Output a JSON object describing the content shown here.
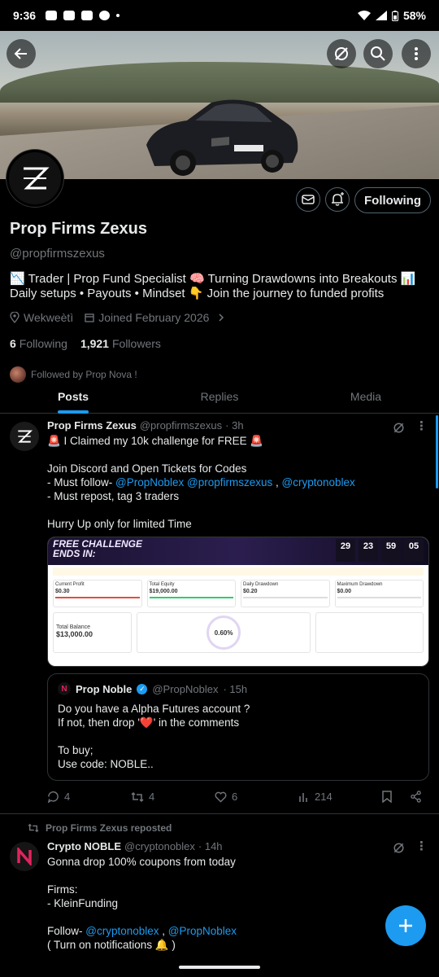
{
  "status_bar": {
    "time": "9:36",
    "battery": "58%"
  },
  "profile": {
    "display_name": "Prop Firms Zexus",
    "handle": "@propfirmszexus",
    "bio": "📉 Trader | Prop Fund Specialist 🧠 Turning Drawdowns into Breakouts 📊 Daily setups • Payouts • Mindset 👇 Join the journey to funded profits",
    "location": "Wekweètì",
    "joined": "Joined February 2026",
    "following_count": "6",
    "following_label": "Following",
    "followers_count": "1,921",
    "followers_label": "Followers",
    "followed_by": "Followed by Prop Nova !",
    "following_button": "Following"
  },
  "tabs": [
    {
      "label": "Posts",
      "active": true
    },
    {
      "label": "Replies",
      "active": false
    },
    {
      "label": "Media",
      "active": false
    }
  ],
  "post1": {
    "name": "Prop Firms Zexus",
    "handle": "@propfirmszexus",
    "time": "· 3h",
    "line1": "🚨 I Claimed my 10k challenge for FREE 🚨",
    "line2": "Join Discord and Open Tickets for Codes",
    "line3_prefix": "- Must follow- ",
    "mention1": "@PropNoblex",
    "mention2": "@propfirmszexus",
    "sep": " , ",
    "mention3": "@cryptonoblex",
    "line4": "- Must repost, tag 3 traders",
    "line5": "Hurry Up only for limited Time",
    "image": {
      "title1": "FREE CHALLENGE",
      "title2": "ENDS IN:",
      "counter": [
        "29",
        "23",
        "59",
        "05"
      ],
      "cards": [
        {
          "label": "Current Profit",
          "value": "$0.30"
        },
        {
          "label": "Total Equity",
          "value": "$19,000.00"
        },
        {
          "label": "Daily Drawdown",
          "value": "$0.20"
        },
        {
          "label": "Maximum Drawdown",
          "value": "$0.00"
        }
      ],
      "balance_label": "Total Balance",
      "balance_value": "$13,000.00",
      "circle_value": "0.60%"
    },
    "quote": {
      "name": "Prop Noble",
      "handle": "@PropNoblex",
      "time": "· 15h",
      "line1": "Do you have a Alpha Futures account ?",
      "line2": "If not, then drop '❤️' in the comments",
      "line3": "To buy;",
      "line4": "Use code: NOBLE.."
    },
    "replies": "4",
    "reposts": "4",
    "likes": "6",
    "views": "214"
  },
  "post2": {
    "repost_label": "Prop Firms Zexus reposted",
    "name": "Crypto NOBLE",
    "handle": "@cryptonoblex",
    "time": "· 14h",
    "line1": "Gonna drop 100% coupons from today",
    "line2": "Firms:",
    "line3": "- KleinFunding",
    "line4_prefix": "Follow- ",
    "mention1": "@cryptonoblex",
    "sep": " , ",
    "mention2": "@PropNoblex",
    "line5": "( Turn on notifications 🔔 )"
  },
  "colors": {
    "accent": "#1d9bf0",
    "background": "#000000",
    "muted": "#71767b",
    "text": "#e7e9ea"
  }
}
